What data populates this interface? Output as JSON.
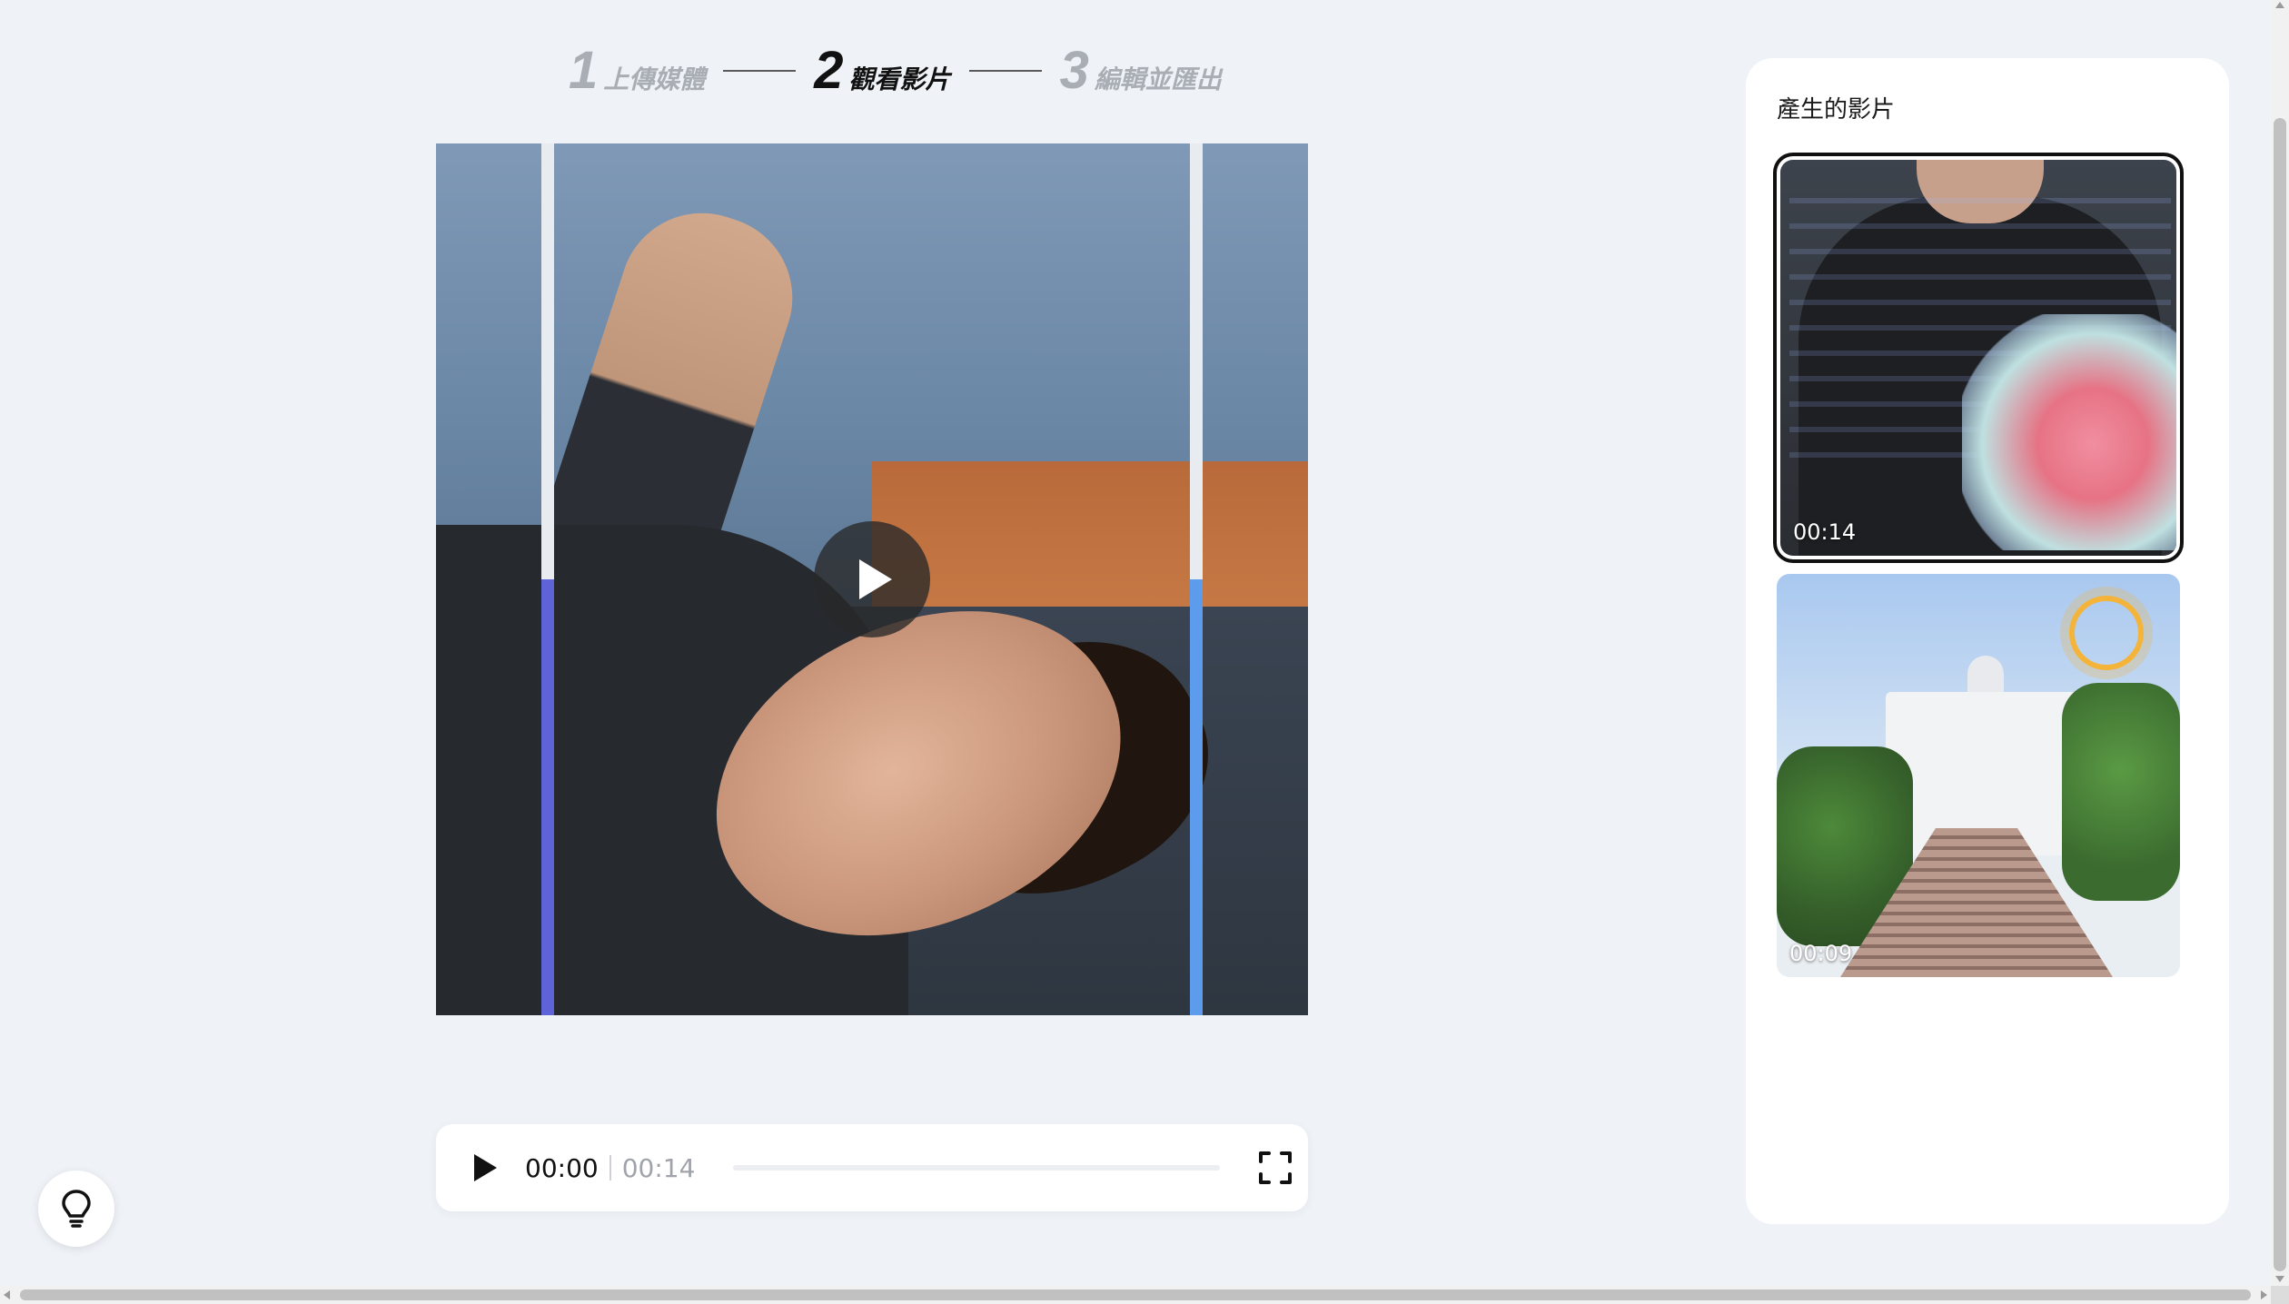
{
  "stepper": {
    "steps": [
      {
        "number": "1",
        "label": "上傳媒體",
        "state": "inactive"
      },
      {
        "number": "2",
        "label": "觀看影片",
        "state": "active"
      },
      {
        "number": "3",
        "label": "編輯並匯出",
        "state": "inactive"
      }
    ]
  },
  "player": {
    "current_time": "00:00",
    "total_time": "00:14",
    "progress": 0,
    "play_icon": "play-icon",
    "fullscreen_icon": "fullscreen-icon"
  },
  "help": {
    "icon": "lightbulb-icon"
  },
  "sidebar": {
    "title": "產生的影片",
    "videos": [
      {
        "duration": "00:14",
        "selected": true
      },
      {
        "duration": "00:09",
        "selected": false
      }
    ]
  },
  "colors": {
    "background": "#eff3f7",
    "panel": "#ffffff",
    "active_step": "#111111",
    "inactive_step": "#a9aeb4",
    "rail_left_accent": "#5e63d8",
    "rail_right_accent": "#5d9cec"
  }
}
